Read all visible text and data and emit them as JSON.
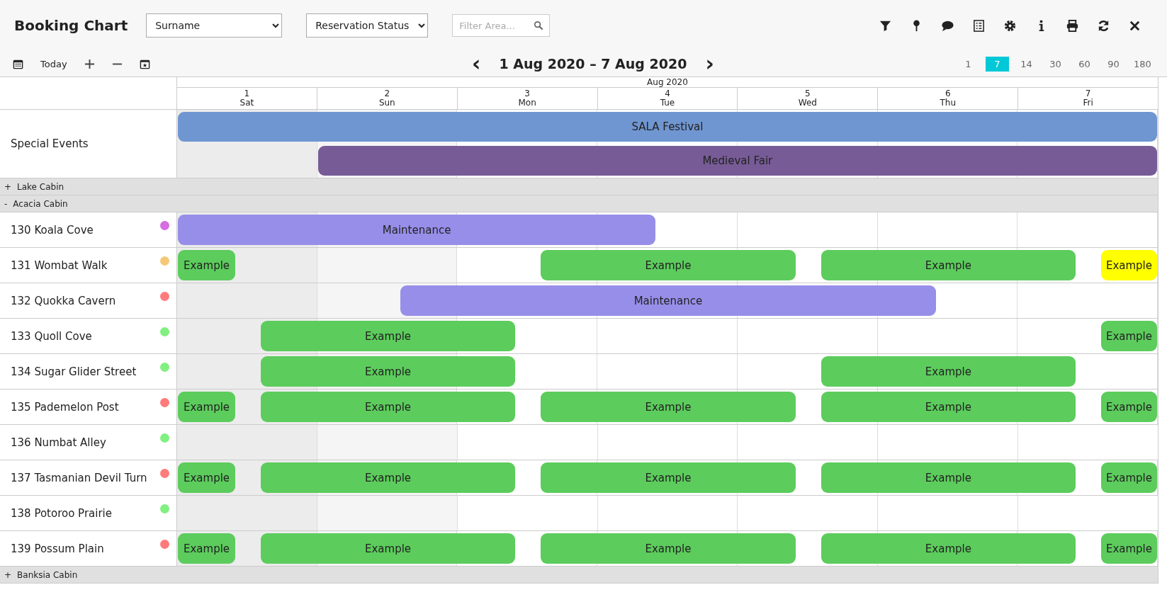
{
  "header": {
    "title": "Booking Chart",
    "dropdowns": [
      {
        "value": "Surname"
      },
      {
        "value": "Reservation Status"
      }
    ],
    "filter": {
      "placeholder": "Filter Area..."
    }
  },
  "toolbar": {
    "today": "Today",
    "date_range": "1 Aug 2020 – 7 Aug 2020",
    "prev": "‹",
    "next": "›",
    "zoom_options": [
      {
        "label": "1",
        "selected": false
      },
      {
        "label": "7",
        "selected": true
      },
      {
        "label": "14",
        "selected": false
      },
      {
        "label": "30",
        "selected": false
      },
      {
        "label": "60",
        "selected": false
      },
      {
        "label": "90",
        "selected": false
      },
      {
        "label": "180",
        "selected": false
      }
    ]
  },
  "chart": {
    "month": "Aug 2020",
    "days": [
      {
        "date": "1",
        "weekday": "Sat",
        "past": true,
        "weekend": true
      },
      {
        "date": "2",
        "weekday": "Sun",
        "past": false,
        "weekend": true
      },
      {
        "date": "3",
        "weekday": "Mon",
        "past": false,
        "weekend": false
      },
      {
        "date": "4",
        "weekday": "Tue",
        "past": false,
        "weekend": false
      },
      {
        "date": "5",
        "weekday": "Wed",
        "past": false,
        "weekend": false
      },
      {
        "date": "6",
        "weekday": "Thu",
        "past": false,
        "weekend": false
      },
      {
        "date": "7",
        "weekday": "Fri",
        "past": false,
        "weekend": false
      }
    ],
    "special_events": {
      "label": "Special Events",
      "events": [
        {
          "name": "SALA Festival",
          "color": "#7096d1"
        },
        {
          "name": "Medieval Fair",
          "color": "#775b96"
        }
      ]
    },
    "groups": [
      {
        "toggle": "+",
        "name": "Lake Cabin"
      },
      {
        "toggle": "-",
        "name": "Acacia Cabin",
        "rooms": [
          {
            "name": "130 Koala Cove",
            "color": "#d66de0",
            "bookings": [
              {
                "label": "Maintenance",
                "color": "#978ee9"
              }
            ]
          },
          {
            "name": "131 Wombat Walk",
            "color": "#f5c878",
            "bookings": [
              {
                "label": "Example",
                "color": "#5ccc5c"
              },
              {
                "label": "Example",
                "color": "#5ccc5c"
              },
              {
                "label": "Example",
                "color": "#5ccc5c"
              },
              {
                "label": "Example",
                "color": "#ffff00"
              }
            ]
          },
          {
            "name": "132 Quokka Cavern",
            "color": "#ff7b7b",
            "bookings": [
              {
                "label": "Maintenance",
                "color": "#978ee9"
              }
            ]
          },
          {
            "name": "133 Quoll Cove",
            "color": "#80f080",
            "bookings": [
              {
                "label": "Example",
                "color": "#5ccc5c"
              },
              {
                "label": "Example",
                "color": "#5ccc5c"
              }
            ]
          },
          {
            "name": "134 Sugar Glider Street",
            "color": "#80f080",
            "bookings": [
              {
                "label": "Example",
                "color": "#5ccc5c"
              },
              {
                "label": "Example",
                "color": "#5ccc5c"
              }
            ]
          },
          {
            "name": "135 Pademelon Post",
            "color": "#ff7b7b",
            "bookings": [
              {
                "label": "Example",
                "color": "#5ccc5c"
              },
              {
                "label": "Example",
                "color": "#5ccc5c"
              },
              {
                "label": "Example",
                "color": "#5ccc5c"
              },
              {
                "label": "Example",
                "color": "#5ccc5c"
              },
              {
                "label": "Example",
                "color": "#5ccc5c"
              }
            ]
          },
          {
            "name": "136 Numbat Alley",
            "color": "#80f080"
          },
          {
            "name": "137 Tasmanian Devil Turn",
            "color": "#ff7b7b",
            "bookings": [
              {
                "label": "Example",
                "color": "#5ccc5c"
              },
              {
                "label": "Example",
                "color": "#5ccc5c"
              },
              {
                "label": "Example",
                "color": "#5ccc5c"
              },
              {
                "label": "Example",
                "color": "#5ccc5c"
              },
              {
                "label": "Example",
                "color": "#5ccc5c"
              }
            ]
          },
          {
            "name": "138 Potoroo Prairie",
            "color": "#80f080"
          },
          {
            "name": "139 Possum Plain",
            "color": "#ff7b7b",
            "bookings": [
              {
                "label": "Example",
                "color": "#5ccc5c"
              },
              {
                "label": "Example",
                "color": "#5ccc5c"
              },
              {
                "label": "Example",
                "color": "#5ccc5c"
              },
              {
                "label": "Example",
                "color": "#5ccc5c"
              },
              {
                "label": "Example",
                "color": "#5ccc5c"
              }
            ]
          }
        ]
      },
      {
        "toggle": "+",
        "name": "Banksia Cabin"
      }
    ]
  }
}
